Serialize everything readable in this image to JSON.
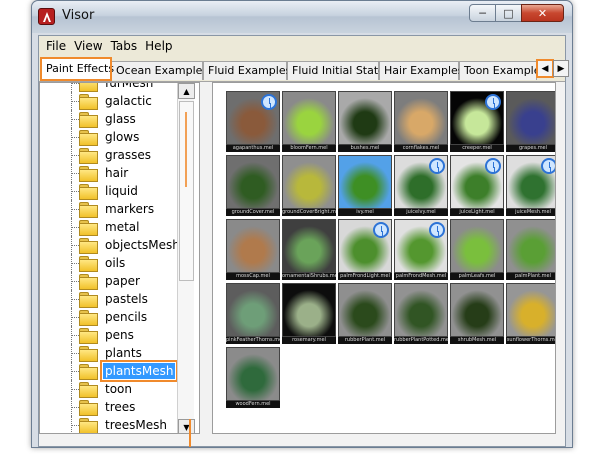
{
  "window": {
    "title": "Visor"
  },
  "menu": [
    "File",
    "View",
    "Tabs",
    "Help"
  ],
  "tabs": [
    {
      "label": "Paint Effects",
      "active": true
    },
    {
      "label": "Ocean Examples"
    },
    {
      "label": "Fluid Examples"
    },
    {
      "label": "Fluid Initial States"
    },
    {
      "label": "Hair Examples"
    },
    {
      "label": "Toon Examples"
    }
  ],
  "tree": {
    "items": [
      "furMesh",
      "galactic",
      "glass",
      "glows",
      "grasses",
      "hair",
      "liquid",
      "markers",
      "metal",
      "objectsMesh",
      "oils",
      "paper",
      "pastels",
      "pencils",
      "pens",
      "plants",
      "plantsMesh",
      "toon",
      "trees",
      "treesMesh"
    ],
    "selected": "plantsMesh"
  },
  "gallery": {
    "items": [
      {
        "caption": "agapanthus.mel",
        "clock": true,
        "bg": "#6e6e6e",
        "fg": "#8a5a3b"
      },
      {
        "caption": "bloomFern.mel",
        "clock": false,
        "bg": "#8a8a8a",
        "fg": "#9ad43f"
      },
      {
        "caption": "bushes.mel",
        "clock": false,
        "bg": "#a9a9a9",
        "fg": "#1f3a14"
      },
      {
        "caption": "cornflakes.mel",
        "clock": false,
        "bg": "#7d7d7d",
        "fg": "#d8a868"
      },
      {
        "caption": "creeper.mel",
        "clock": true,
        "bg": "#050505",
        "fg": "#c6e79a"
      },
      {
        "caption": "grapes.mel",
        "clock": false,
        "bg": "#5a5a5a",
        "fg": "#39408e"
      },
      {
        "caption": "groundCover.mel",
        "clock": false,
        "bg": "#6f6f6f",
        "fg": "#2f5c22"
      },
      {
        "caption": "groundCoverBright.mel",
        "clock": false,
        "bg": "#8f8f8f",
        "fg": "#b8b83b"
      },
      {
        "caption": "ivy.mel",
        "clock": false,
        "bg": "#53a1e8",
        "fg": "#3e8f24"
      },
      {
        "caption": "juiceIvy.mel",
        "clock": true,
        "bg": "#dcdcdc",
        "fg": "#2e6e2a"
      },
      {
        "caption": "juiceLight.mel",
        "clock": true,
        "bg": "#e4e4e4",
        "fg": "#3d7f2a"
      },
      {
        "caption": "juiceMesh.mel",
        "clock": true,
        "bg": "#dedede",
        "fg": "#2f7230"
      },
      {
        "caption": "mossCap.mel",
        "clock": false,
        "bg": "#8a8a8a",
        "fg": "#b07a4c"
      },
      {
        "caption": "ornamentalShrubs.mel",
        "clock": false,
        "bg": "#3f3f3f",
        "fg": "#6aa35a"
      },
      {
        "caption": "palmFrondLight.mel",
        "clock": true,
        "bg": "#d8d8d8",
        "fg": "#4d8f2d"
      },
      {
        "caption": "palmFrondMesh.mel",
        "clock": true,
        "bg": "#e0e0e0",
        "fg": "#54972f"
      },
      {
        "caption": "palmLeafs.mel",
        "clock": false,
        "bg": "#8c8c8c",
        "fg": "#7abf3d"
      },
      {
        "caption": "palmPlant.mel",
        "clock": false,
        "bg": "#909090",
        "fg": "#5a9f35"
      },
      {
        "caption": "pinkFeatherThorns.mel",
        "clock": false,
        "bg": "#5d5d5d",
        "fg": "#6e9e78"
      },
      {
        "caption": "rosemary.mel",
        "clock": false,
        "bg": "#0d0d0d",
        "fg": "#9bb089"
      },
      {
        "caption": "rubberPlant.mel",
        "clock": false,
        "bg": "#8f8f8f",
        "fg": "#2b4a1c"
      },
      {
        "caption": "rubberPlantPotted.mel",
        "clock": false,
        "bg": "#929292",
        "fg": "#315524"
      },
      {
        "caption": "shrubMesh.mel",
        "clock": false,
        "bg": "#919191",
        "fg": "#263d18"
      },
      {
        "caption": "sunflowerThorns.mel",
        "clock": false,
        "bg": "#969696",
        "fg": "#d8b02b"
      },
      {
        "caption": "woodFern.mel",
        "clock": false,
        "bg": "#8b8b8b",
        "fg": "#2f6a3c"
      }
    ]
  }
}
